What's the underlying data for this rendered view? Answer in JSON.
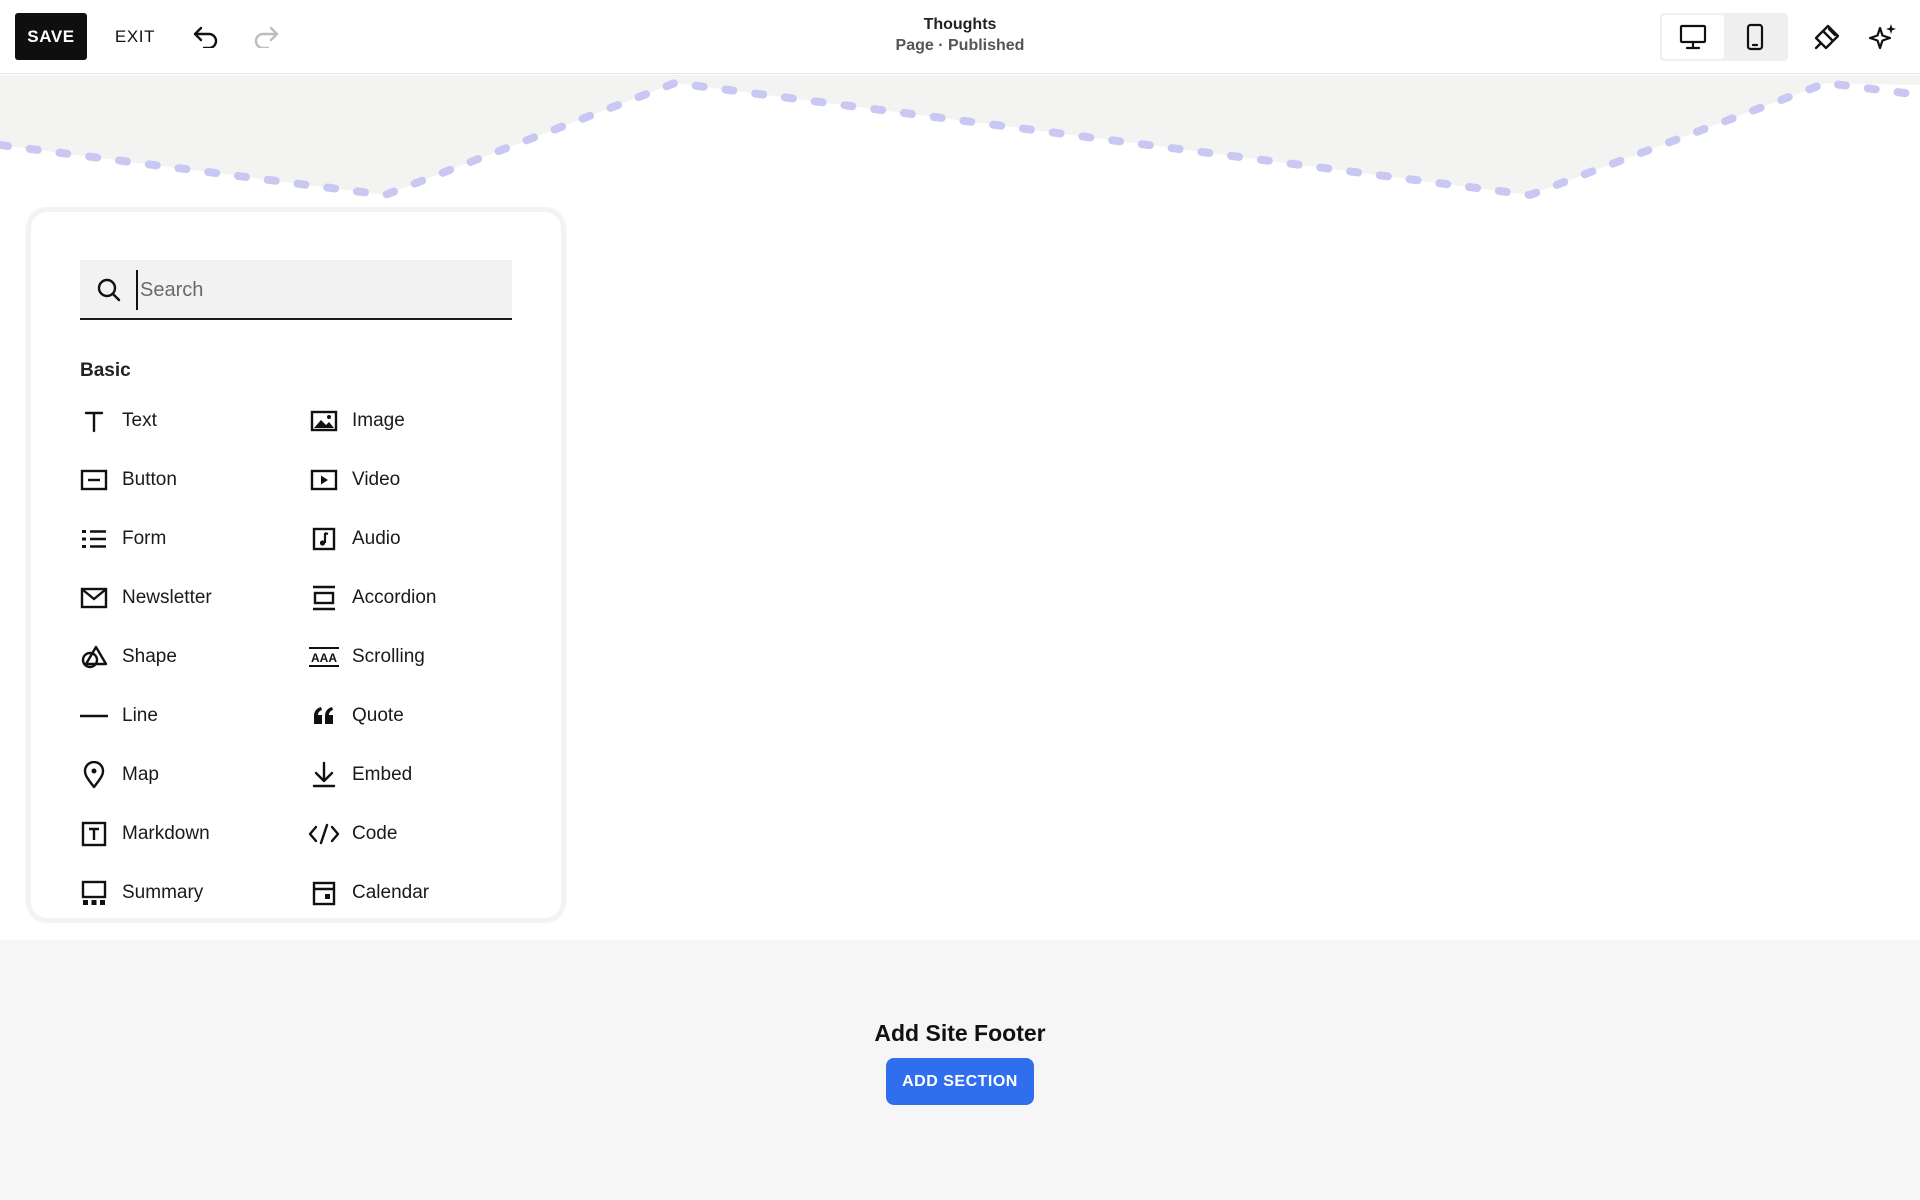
{
  "toolbar": {
    "save_label": "SAVE",
    "exit_label": "EXIT",
    "page_title": "Thoughts",
    "page_status": "Page · Published"
  },
  "search": {
    "placeholder": "Search",
    "value": ""
  },
  "blocks": {
    "section_label": "Basic",
    "items": [
      {
        "label": "Text",
        "icon": "text-icon"
      },
      {
        "label": "Image",
        "icon": "image-icon"
      },
      {
        "label": "Button",
        "icon": "button-icon"
      },
      {
        "label": "Video",
        "icon": "video-icon"
      },
      {
        "label": "Form",
        "icon": "form-icon"
      },
      {
        "label": "Audio",
        "icon": "audio-icon"
      },
      {
        "label": "Newsletter",
        "icon": "newsletter-icon"
      },
      {
        "label": "Accordion",
        "icon": "accordion-icon"
      },
      {
        "label": "Shape",
        "icon": "shape-icon"
      },
      {
        "label": "Scrolling",
        "icon": "scrolling-icon"
      },
      {
        "label": "Line",
        "icon": "line-icon"
      },
      {
        "label": "Quote",
        "icon": "quote-icon"
      },
      {
        "label": "Map",
        "icon": "map-pin-icon"
      },
      {
        "label": "Embed",
        "icon": "embed-icon"
      },
      {
        "label": "Markdown",
        "icon": "markdown-icon"
      },
      {
        "label": "Code",
        "icon": "code-icon"
      },
      {
        "label": "Summary",
        "icon": "summary-icon"
      },
      {
        "label": "Calendar",
        "icon": "calendar-icon"
      }
    ]
  },
  "footer": {
    "title": "Add Site Footer",
    "button_label": "ADD SECTION"
  },
  "colors": {
    "save_bg": "#0f0f0f",
    "accent_blue": "#2f6fed",
    "band_bg": "#f3f3f2",
    "dash_color": "#c9c8f2",
    "footer_bg": "#f6f6f6"
  }
}
